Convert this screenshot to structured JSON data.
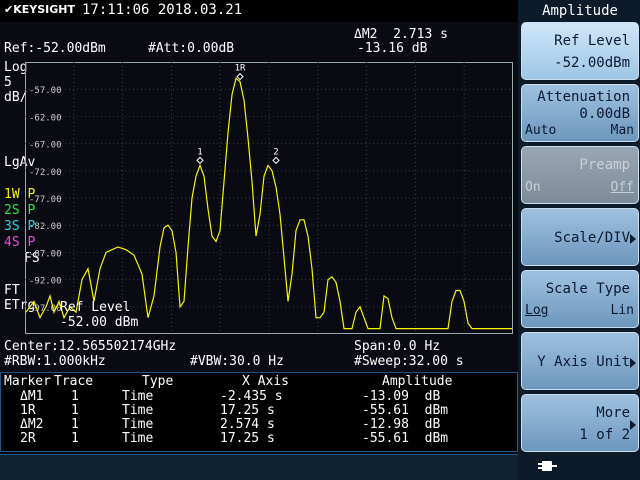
{
  "header": {
    "brand": "KEYSIGHT",
    "datetime": "17:11:06  2018.03.21"
  },
  "readouts": {
    "ref": "Ref:-52.00dBm",
    "att": "#Att:0.00dB",
    "delta_marker_line1": "ΔM2  2.713 s",
    "delta_marker_line2": "-13.16 dB",
    "scale_type": "Log",
    "scale_div_value": "5",
    "scale_div_unit": "dB/",
    "avg": "LgAv",
    "traces": [
      {
        "label": "1W",
        "mode": "P",
        "color": "#f5f500"
      },
      {
        "label": "2S",
        "mode": "P",
        "color": "#27e64a"
      },
      {
        "label": "3S",
        "mode": "P",
        "color": "#27d7e6"
      },
      {
        "label": "4S",
        "mode": "P",
        "color": "#e64ad7"
      }
    ],
    "fs": "FS",
    "ft": "FT",
    "etrg": "ETrg",
    "center": "Center:12.565502174GHz",
    "span": "Span:0.0 Hz",
    "rbw": "#RBW:1.000kHz",
    "vbw": "#VBW:30.0 Hz",
    "sweep": "#Sweep:32.00 s",
    "ref_level_overlay_line1": "Ref Level",
    "ref_level_overlay_line2": "-52.00 dBm"
  },
  "chart_data": {
    "type": "line",
    "ylabels": [
      "-57.00",
      "-62.00",
      "-67.00",
      "-72.00",
      "-77.00",
      "-82.00",
      "-87.00",
      "-92.00",
      "-97.00"
    ],
    "marker_labels": [
      "1",
      "1R",
      "2"
    ],
    "trace_color": "#f5f500",
    "series": [
      {
        "x": [
          0,
          8,
          14,
          20,
          24,
          28,
          33,
          38,
          44,
          50,
          56,
          62,
          68,
          74,
          80,
          86,
          92,
          100,
          108,
          116,
          122,
          128,
          134,
          138,
          142,
          146,
          150,
          154,
          158,
          162,
          166,
          170,
          174,
          178,
          182,
          186,
          190,
          194,
          198,
          202,
          206,
          210,
          214,
          218,
          222,
          226,
          230,
          234,
          238,
          242,
          246,
          250,
          254,
          258,
          262,
          266,
          270,
          274,
          278,
          282,
          286,
          290,
          294,
          298,
          302,
          306,
          310,
          314,
          318,
          322,
          326,
          330,
          334,
          338,
          342,
          346,
          350,
          354,
          358,
          362,
          366,
          370,
          374,
          378,
          382,
          386,
          390,
          394,
          398,
          402,
          406,
          410,
          414,
          418,
          422,
          426,
          430,
          434,
          438,
          442,
          446,
          450,
          454,
          458,
          462,
          466,
          470,
          474,
          478,
          482,
          486
        ],
        "y": [
          -98,
          -96,
          -99,
          -97,
          -95,
          -98,
          -96,
          -99,
          -97,
          -98,
          -92,
          -90,
          -96,
          -90,
          -87,
          -86.5,
          -86,
          -86.5,
          -87.5,
          -91,
          -99,
          -95,
          -86,
          -82.5,
          -82,
          -83,
          -87,
          -97,
          -96,
          -86,
          -77,
          -73,
          -71,
          -73,
          -79,
          -84,
          -85,
          -83,
          -74,
          -65,
          -58,
          -55,
          -55.6,
          -59,
          -66,
          -74,
          -84,
          -80,
          -73,
          -71,
          -72,
          -75,
          -80,
          -88,
          -96,
          -91,
          -83,
          -81,
          -81,
          -84,
          -90,
          -99,
          -99,
          -98,
          -92,
          -91.5,
          -92.5,
          -96,
          -101,
          -101,
          -101,
          -98,
          -97,
          -99,
          -101,
          -101,
          -101,
          -101,
          -95,
          -95.5,
          -99,
          -101,
          -101,
          -101,
          -101,
          -101,
          -101,
          -101,
          -101,
          -101,
          -101,
          -101,
          -101,
          -101,
          -101,
          -96,
          -94,
          -94,
          -96,
          -100,
          -101,
          -101,
          -101,
          -101,
          -101,
          -101,
          -101,
          -101,
          -101,
          -101,
          -101
        ]
      }
    ],
    "markers": [
      {
        "label": "1",
        "x": 174,
        "y": -71
      },
      {
        "label": "1R",
        "x": 214,
        "y": -55.6
      },
      {
        "label": "2",
        "x": 250,
        "y": -71
      }
    ],
    "ylim": [
      -102,
      -52
    ],
    "xlim": [
      0,
      486
    ],
    "grid": true
  },
  "marker_table": {
    "headers": [
      "Marker",
      "Trace",
      "Type",
      "X Axis",
      "Amplitude"
    ],
    "rows": [
      {
        "marker": "ΔM1",
        "trace": "1",
        "type": "Time",
        "x": "-2.435 s",
        "amp": "-13.09  dB"
      },
      {
        "marker": "1R",
        "trace": "1",
        "type": "Time",
        "x": "17.25 s",
        "amp": "-55.61  dBm"
      },
      {
        "marker": "ΔM2",
        "trace": "1",
        "type": "Time",
        "x": "2.574 s",
        "amp": "-12.98  dB"
      },
      {
        "marker": "2R",
        "trace": "1",
        "type": "Time",
        "x": "17.25 s",
        "amp": "-55.61  dBm"
      }
    ]
  },
  "softkeys": {
    "title": "Amplitude",
    "ref_level": {
      "label": "Ref Level",
      "value": "-52.00dBm"
    },
    "attenuation": {
      "label": "Attenuation",
      "value": "0.00dB",
      "left": "Auto",
      "right": "Man"
    },
    "preamp": {
      "label": "Preamp",
      "left": "On",
      "right": "Off"
    },
    "scale_div": {
      "label": "Scale/DIV"
    },
    "scale_type": {
      "label": "Scale Type",
      "left": "Log",
      "right": "Lin"
    },
    "y_axis_unit": {
      "label": "Y Axis Unit"
    },
    "more": {
      "label": "More",
      "page": "1 of 2"
    }
  }
}
